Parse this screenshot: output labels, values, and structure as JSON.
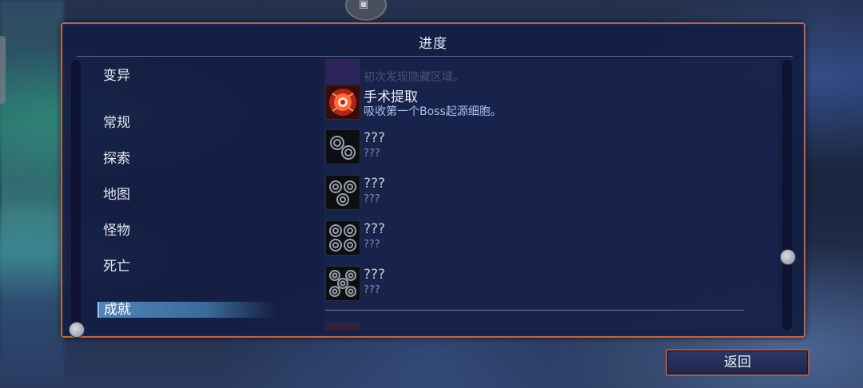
{
  "panel": {
    "title": "进度"
  },
  "categories": [
    {
      "label": "变异",
      "selected": false
    },
    {
      "label": "常规",
      "selected": false
    },
    {
      "label": "探索",
      "selected": false
    },
    {
      "label": "地图",
      "selected": false
    },
    {
      "label": "怪物",
      "selected": false
    },
    {
      "label": "死亡",
      "selected": false
    },
    {
      "label": "成就",
      "selected": true
    }
  ],
  "achievements": [
    {
      "title": "",
      "desc": "初次发现隐藏区域。",
      "icon": "purple-badge-icon",
      "faded": true
    },
    {
      "title": "手术提取",
      "desc": "吸收第一个Boss起源细胞。",
      "icon": "boss-cell-icon",
      "faded": false
    },
    {
      "title": "???",
      "desc": "???",
      "icon": "locked-cells-2-icon",
      "faded": false
    },
    {
      "title": "???",
      "desc": "???",
      "icon": "locked-cells-3-icon",
      "faded": false
    },
    {
      "title": "???",
      "desc": "???",
      "icon": "locked-cells-4-icon",
      "faded": false
    },
    {
      "title": "???",
      "desc": "???",
      "icon": "locked-cells-5-icon",
      "faded": false
    },
    {
      "title": "",
      "desc": "",
      "icon": "next-red-icon",
      "faded": true
    }
  ],
  "footer": {
    "back_label": "返回"
  },
  "colors": {
    "frame": "#b8654a",
    "panel": "#141e44",
    "selected": "#4f86b8",
    "desc": "#a8c0ee"
  }
}
